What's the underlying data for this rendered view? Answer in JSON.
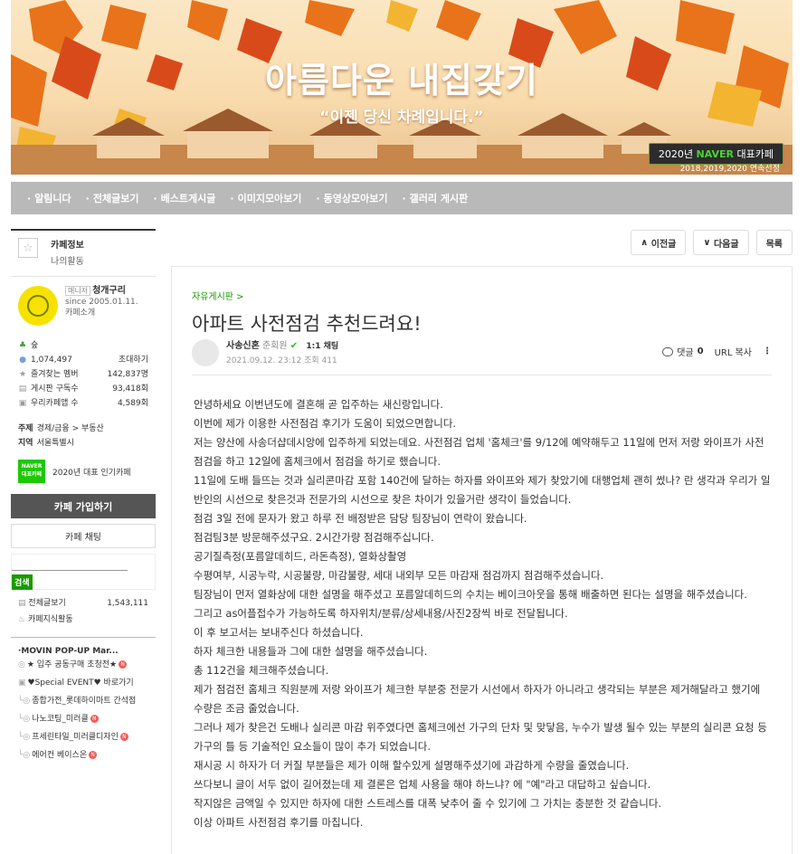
{
  "banner": {
    "title": "아름다운 내집갖기",
    "subtitle": "“이젠 당신 차례입니다.”",
    "award_year": "2020년",
    "award_naver": "NAVER",
    "award_label": "대표카페",
    "award_years": "2018,2019,2020 연속선정"
  },
  "nav": [
    "알림니다",
    "전체글보기",
    "베스트게시글",
    "이미지모아보기",
    "동영상모아보기",
    "갤러리 게시판"
  ],
  "sidebar": {
    "tab_info": "카페정보",
    "tab_activity": "나의활동",
    "manager_badge": "매니저",
    "manager_name": "청개구리",
    "since": "since 2005.01.11.",
    "cafe_intro": "카페소개",
    "level": "숲",
    "members": "1,074,497",
    "invite": "초대하기",
    "fav_members_label": "즐겨찾는 멤버",
    "fav_members_value": "142,837명",
    "board_sub_label": "게시판 구독수",
    "board_sub_value": "93,418회",
    "cafe_app_label": "우리카페앱 수",
    "cafe_app_value": "4,589회",
    "subject_label": "주제",
    "subject_value": "경제/금융 > 부동산",
    "region_label": "지역",
    "region_value": "서울특별시",
    "naver_badge_top": "NAVER",
    "naver_badge_bottom": "대표카페",
    "popular": "2020년 대표 인기카페",
    "join": "카페 가입하기",
    "chat": "카페 채팅",
    "search_btn": "검색",
    "all_posts_label": "전체글보기",
    "all_posts_value": "1,543,111",
    "knowledge": "카페지식활동",
    "board_group": "·MOVIN POP-UP Mar...",
    "boards": [
      {
        "label": "★ 입주 공동구매 초청전★",
        "new": "N"
      },
      {
        "label": "♥Special EVENT♥ 바로가기",
        "new": ""
      },
      {
        "label": "종합가전_롯데하이마트 간석점",
        "new": ""
      },
      {
        "label": "나노코팅_미러클",
        "new": "N"
      },
      {
        "label": "프세린타일_미러클디자인",
        "new": "N"
      },
      {
        "label": "에어컨 베이스온",
        "new": "N"
      }
    ]
  },
  "top_buttons": {
    "prev": "이전글",
    "next": "다음글",
    "list": "목록"
  },
  "article": {
    "crumb": "자유게시판 >",
    "title": "아파트 사전점검 추천드려요!",
    "author": "사송신혼",
    "grade": "준회원",
    "chat": "1:1 채팅",
    "date": "2021.09.12. 23:12",
    "views": "조회 411",
    "comments_label": "댓글",
    "comments_count": "0",
    "url_copy": "URL 복사",
    "body": [
      "안녕하세요 이번년도에 결혼해 곧 입주하는 새신랑입니다.",
      "이번에 제가 이용한 사전점검 후기가 도움이 되었으면합니다.",
      "저는 양산에 사송더샵데시앙에 입주하게 되었는데요. 사전점검 업체 '홈체크'를 9/12에 예약해두고  11일에 먼저 저랑 와이프가 사전점검을 하고 12일에 홈체크에서 점검을 하기로 했습니다.",
      "11일에 도배 들뜨는 것과 실리콘마감 포함 140건에 달하는 하자를 와이프와 제가 찾았기에 대행업체 괜히 썼나? 란 생각과 우리가 일반인의 시선으로 찾은것과 전문가의 시선으로 찾은 차이가 있을거란 생각이 들었습니다.",
      "점검 3일 전에 문자가 왔고 하루 전 배정받은 담당 팀장님이 연락이 왔습니다.",
      "점검팀3분 방문해주셨구요. 2시간가량 점검해주십니다.",
      "공기질측정(포름알데히드,  라돈측정), 열화상촬영",
      "수평여부, 시공누락, 시공불량, 마감불량, 세대 내외부 모든 마감재 점검까지 점검해주셨습니다.",
      "팀장님이 먼저 열화상에 대한 설명을 해주셨고 포름알데히드의 수치는 베이크아웃을 통해 배출하면 된다는 설명을 해주셨습니다.",
      "그리고 as어플접수가 가능하도록 하자위치/분류/상세내용/사진2장씩 바로 전달됩니다.",
      "이 후 보고서는 보내주신다 하셨습니다.",
      "하자 체크한 내용들과 그에 대한 설명을 해주셨습니다.",
      "총 112건을 체크해주셨습니다.",
      "제가 점검전 홈체크 직원분께 저랑 와이프가 체크한 부분중 전문가 시선에서 하자가 아니라고 생각되는 부분은 제거해달라고 했기에 수량은 조금 줄었습니다.",
      "그러나 제가 찾은건 도배나 실리콘 마감 위주였다면 홈체크에선 가구의 단차 및 맞닿음, 누수가 발생 될수 있는 부분의 실리콘 요청 등 가구의 틀 등 기술적인 요소들이 많이 추가 되었습니다.",
      "재시공 시 하자가 더 커질 부분들은 제가 이해 할수있게 설명해주셨기에 과감하게 수량을 줄였습니다.",
      "쓰다보니 글이 서두 없이 길어졌는데 제 결론은 업체 사용을 해야 하느냐? 에 \"예\"라고 대답하고 싶습니다.",
      "작지않은 금액일 수 있지만 하자에 대한 스트레스를 대폭 낮추어 줄 수 있기에 그 가치는 충분한 것 같습니다.",
      "이상 아파트 사전점검 후기를 마칩니다."
    ]
  },
  "colors": {
    "accent": "#1a9a00",
    "nav_bg": "#b9b9b9",
    "join_bg": "#555555",
    "new_badge": "#f35b57"
  }
}
